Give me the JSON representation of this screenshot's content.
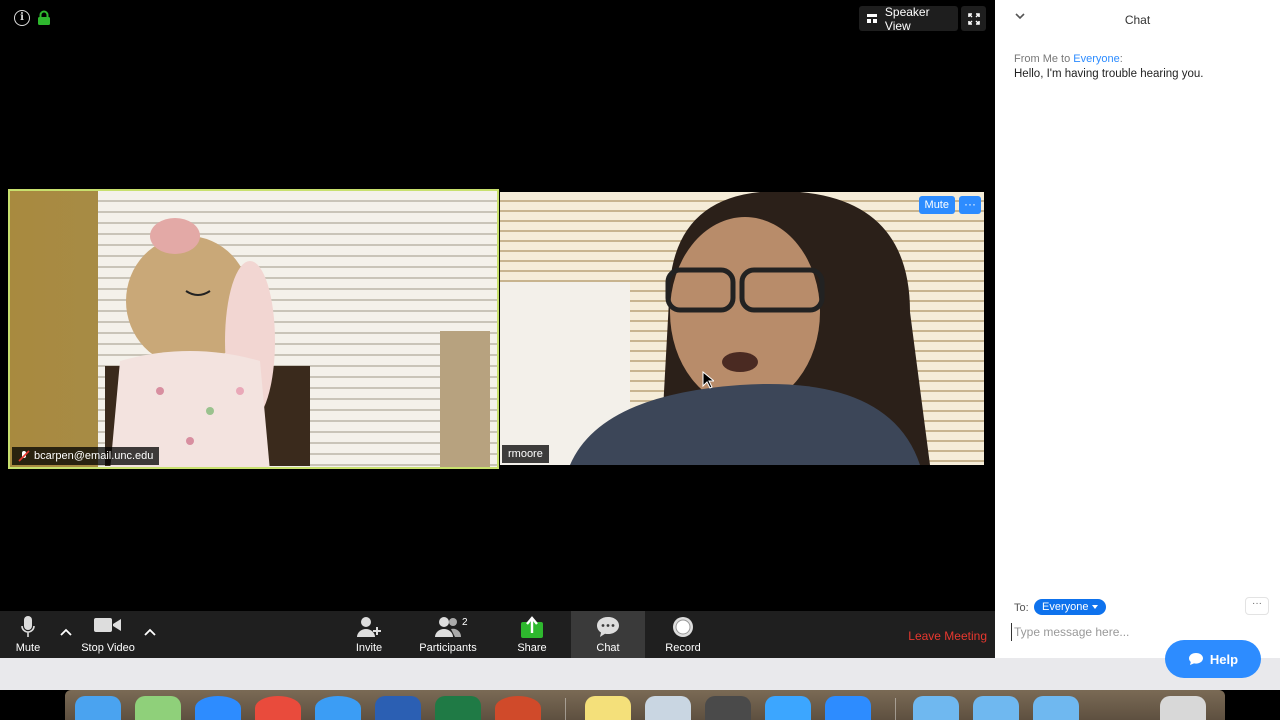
{
  "meeting": {
    "view_button_label": "Speaker View",
    "participants": [
      {
        "name": "bcarpen@email.unc.edu",
        "muted": true
      },
      {
        "name": "rmoore",
        "muted": false
      }
    ],
    "remote_controls": {
      "mute_label": "Mute",
      "more_label": "···"
    }
  },
  "toolbar": {
    "mute_label": "Mute",
    "stop_video_label": "Stop Video",
    "invite_label": "Invite",
    "participants_label": "Participants",
    "participants_count": "2",
    "share_label": "Share",
    "chat_label": "Chat",
    "record_label": "Record",
    "leave_label": "Leave Meeting"
  },
  "chat": {
    "title": "Chat",
    "message": {
      "from_prefix": "From Me to ",
      "to": "Everyone",
      "suffix": ":",
      "text": "Hello, I'm having trouble hearing you."
    },
    "to_label": "To:",
    "recipient": "Everyone",
    "more_label": "···",
    "input_placeholder": "Type message here..."
  },
  "background": {
    "help_label": "Help"
  },
  "colors": {
    "accent": "#2d8cff",
    "active_speaker_border": "#c8e06e",
    "leave": "#e8382f",
    "share": "#2eb82e"
  },
  "dock": {
    "icons": [
      "finder-icon",
      "image-capture-icon",
      "app-store-icon",
      "chrome-icon",
      "safari-icon",
      "word-icon",
      "excel-icon",
      "powerpoint-icon",
      "stickies-icon",
      "preview-icon",
      "calculator-icon",
      "numbers-icon",
      "zoom-icon",
      "folder-icon",
      "folder-icon",
      "folder-icon",
      "trash-icon"
    ]
  }
}
